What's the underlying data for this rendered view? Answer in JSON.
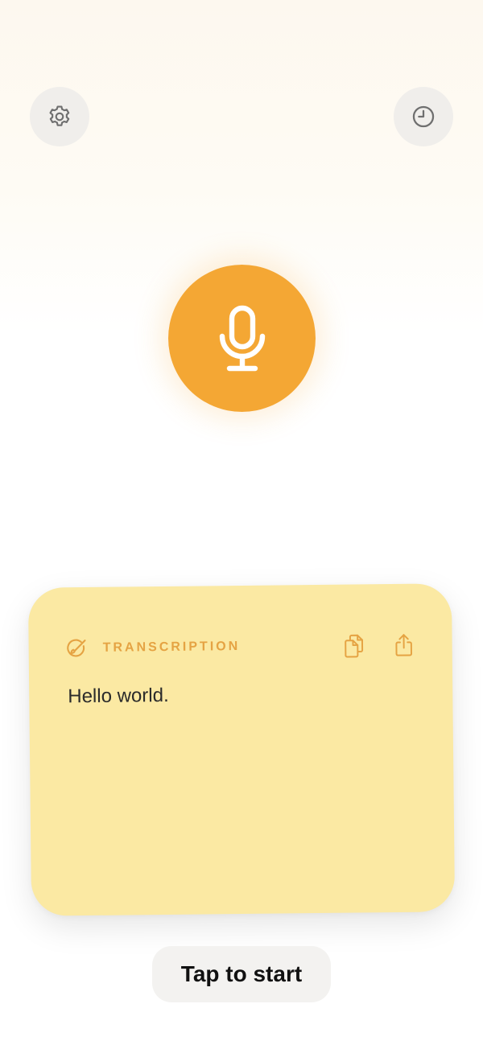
{
  "header": {
    "settings_icon": "gear-icon",
    "history_icon": "clock-icon"
  },
  "mic": {
    "icon": "microphone-icon",
    "color": "#f4a734"
  },
  "card": {
    "title": "TRANSCRIPTION",
    "text": "Hello world.",
    "background": "#fbe9a3",
    "accent": "#e5a343",
    "icons": [
      "brush-icon",
      "copy-icon",
      "share-icon"
    ]
  },
  "footer": {
    "start_label": "Tap to start"
  }
}
